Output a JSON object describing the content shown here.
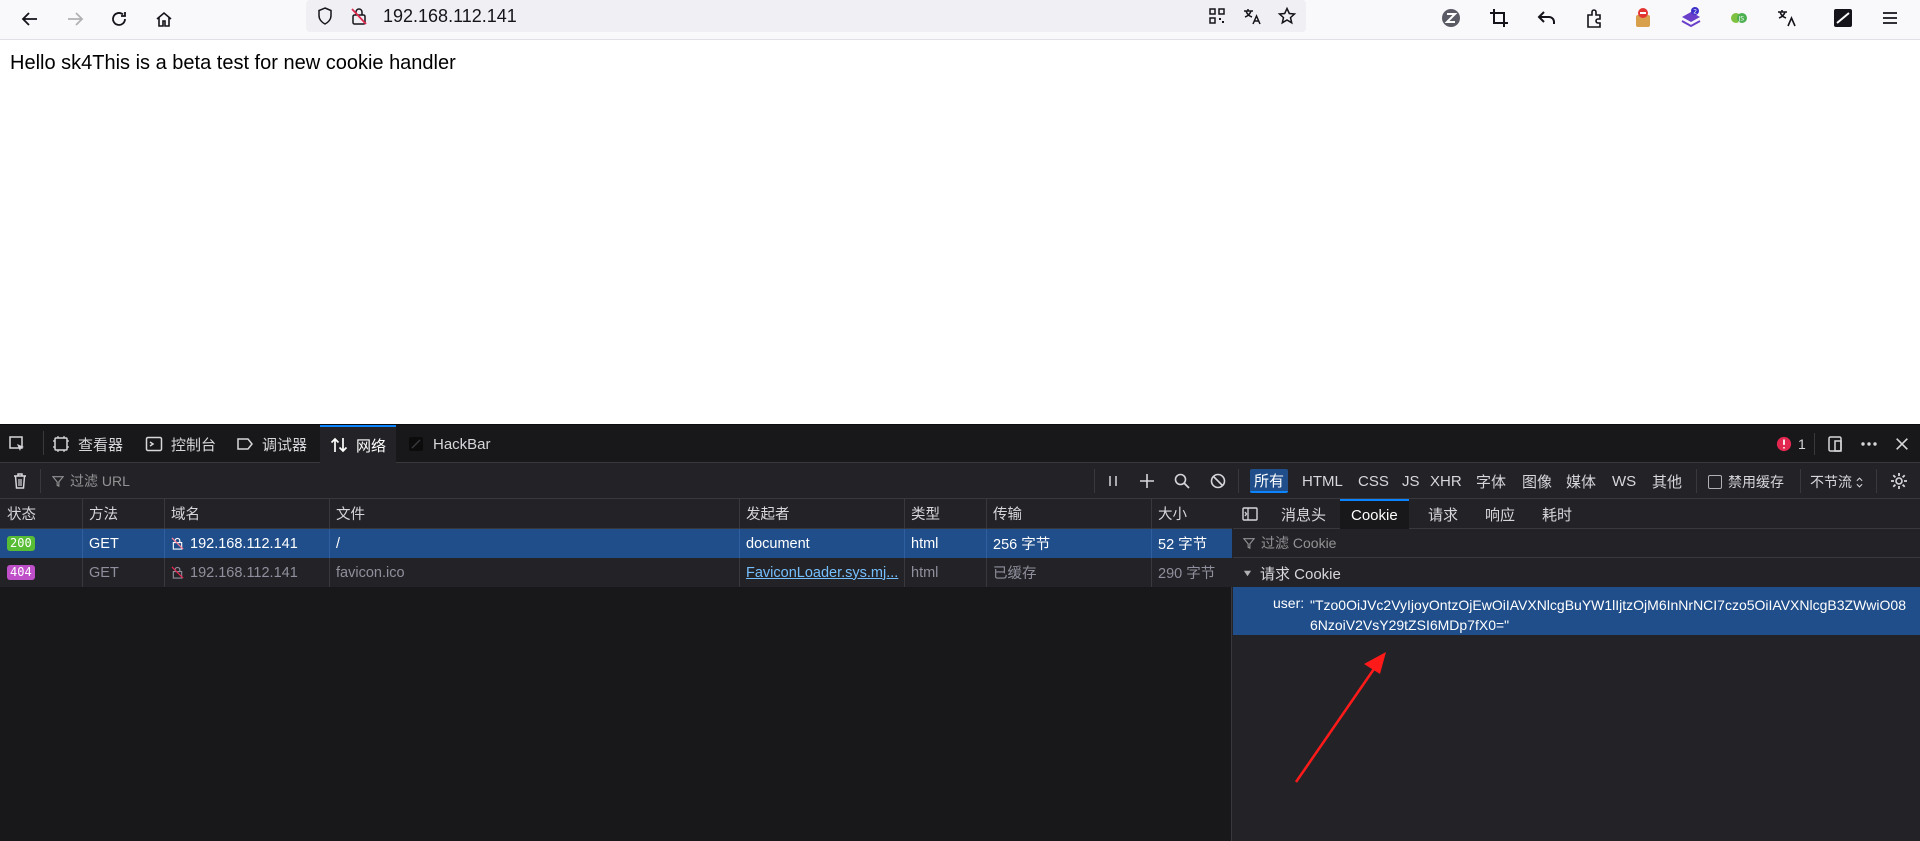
{
  "browser": {
    "url": "192.168.112.141"
  },
  "page": {
    "text": "Hello sk4This is a beta test for new cookie handler"
  },
  "devtools": {
    "tabs": [
      "查看器",
      "控制台",
      "调试器",
      "网络",
      "HackBar"
    ],
    "active_tab": "网络",
    "error_count": "1",
    "filter_url_placeholder": "过滤 URL",
    "type_filters": [
      "所有",
      "HTML",
      "CSS",
      "JS",
      "XHR",
      "字体",
      "图像",
      "媒体",
      "WS",
      "其他"
    ],
    "disable_cache_label": "禁用缓存",
    "throttle_label": "不节流",
    "columns": [
      "状态",
      "方法",
      "域名",
      "文件",
      "发起者",
      "类型",
      "传输",
      "大小"
    ],
    "requests": [
      {
        "status": "200",
        "method": "GET",
        "domain": "192.168.112.141",
        "file": "/",
        "initiator": "document",
        "type": "html",
        "transfer": "256 字节",
        "size": "52 字节"
      },
      {
        "status": "404",
        "method": "GET",
        "domain": "192.168.112.141",
        "file": "favicon.ico",
        "initiator": "FaviconLoader.sys.mj...",
        "type": "html",
        "transfer": "已缓存",
        "size": "290 字节"
      }
    ],
    "side_tabs": [
      "消息头",
      "Cookie",
      "请求",
      "响应",
      "耗时"
    ],
    "active_side_tab": "Cookie",
    "cookie_filter_placeholder": "过滤 Cookie",
    "request_cookie_section": "请求 Cookie",
    "cookie": {
      "name": "user:",
      "value": "\"Tzo0OiJVc2VyIjoyOntzOjEwOiIAVXNlcgBuYW1lIjtzOjM6InNrNCI7czo5OiIAVXNlcgB3ZWwiO086NzoiV2VsY29tZSI6MDp7fX0=\""
    }
  },
  "colors": {
    "accent": "#0a84ff",
    "selected_row": "#204e8a",
    "status_200": "#57bd35",
    "status_404": "#bf4fc8",
    "annotation_arrow": "#ff1a1a"
  }
}
